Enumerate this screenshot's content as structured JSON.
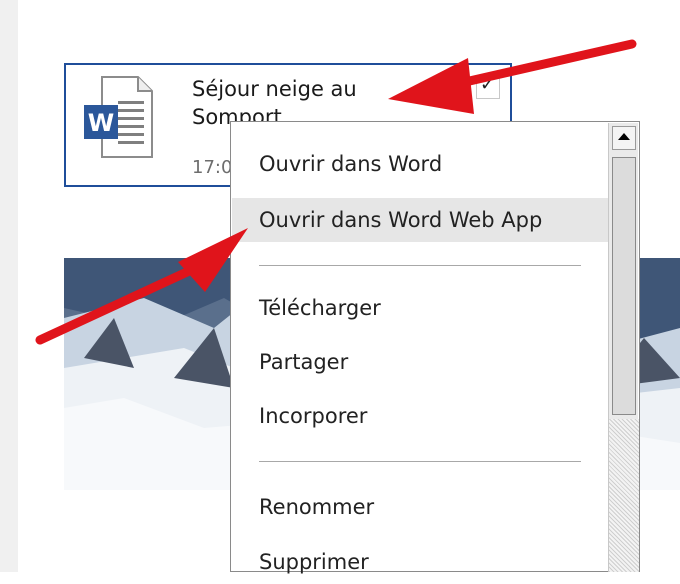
{
  "file": {
    "name": "Séjour neige au Somport",
    "time": "17:0",
    "icon": "word-document-icon"
  },
  "menu": {
    "items": [
      {
        "label": "Ouvrir dans Word"
      },
      {
        "label": "Ouvrir dans Word Web App"
      },
      {
        "label": "Télécharger"
      },
      {
        "label": "Partager"
      },
      {
        "label": "Incorporer"
      },
      {
        "label": "Renommer"
      },
      {
        "label": "Supprimer"
      }
    ],
    "highlighted": "Ouvrir dans Word Web App"
  },
  "colors": {
    "tile_border": "#1f4e9a",
    "word_blue": "#2b579a",
    "annotation_arrow": "#e0141b",
    "menu_highlight": "#e6e6e6"
  }
}
